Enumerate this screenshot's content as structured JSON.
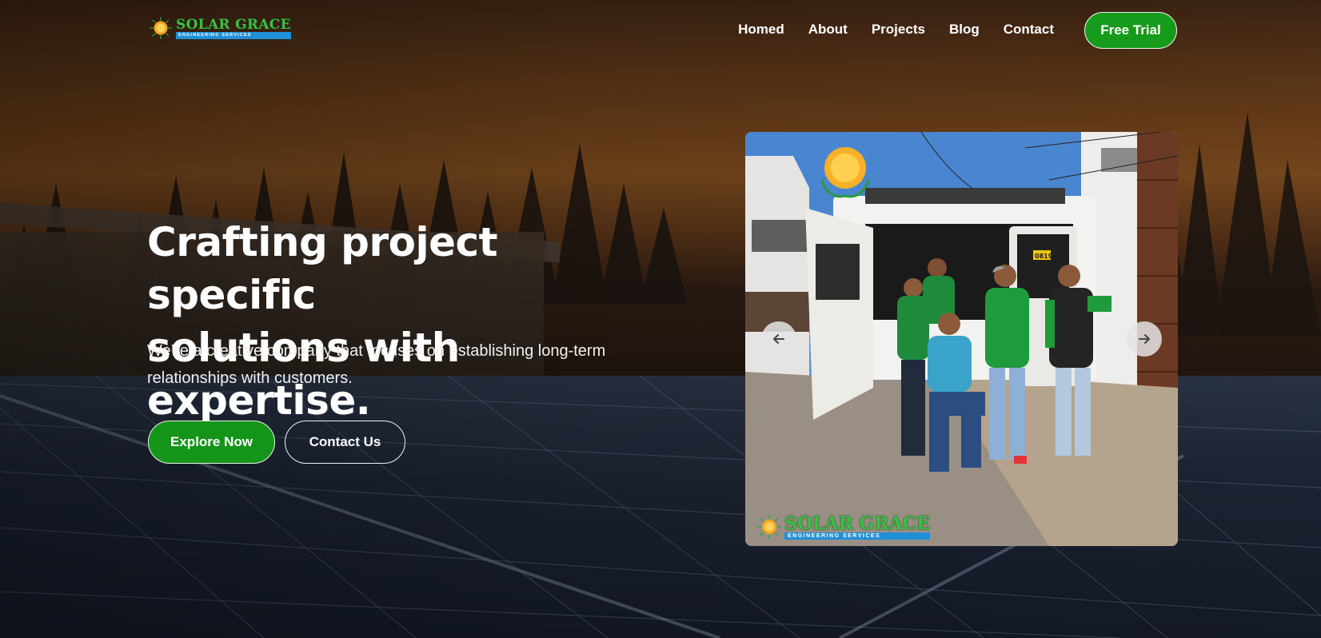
{
  "brand": {
    "name": "SOLAR GRACE",
    "tagline": "ENGINEERING SERVICES",
    "primary_color": "#169b1c",
    "accent_blue": "#1f8fd6"
  },
  "nav": {
    "items": [
      {
        "label": "Homed"
      },
      {
        "label": "About"
      },
      {
        "label": "Projects"
      },
      {
        "label": "Blog"
      },
      {
        "label": "Contact"
      }
    ],
    "cta_label": "Free Trial"
  },
  "hero": {
    "title_line1": "Crafting project specific",
    "title_line2": "solutions with expertise.",
    "description": "We’re a creative company that focuses on establishing long-term relationships with customers.",
    "primary_button": "Explore Now",
    "secondary_button": "Contact Us"
  },
  "slider": {
    "prev_icon": "arrow-left-icon",
    "next_icon": "arrow-right-icon",
    "image_description": "team-photo",
    "watermark_title": "SOLAR GRACE",
    "watermark_sub": "ENGINEERING SERVICES",
    "plate_text": "0819"
  }
}
